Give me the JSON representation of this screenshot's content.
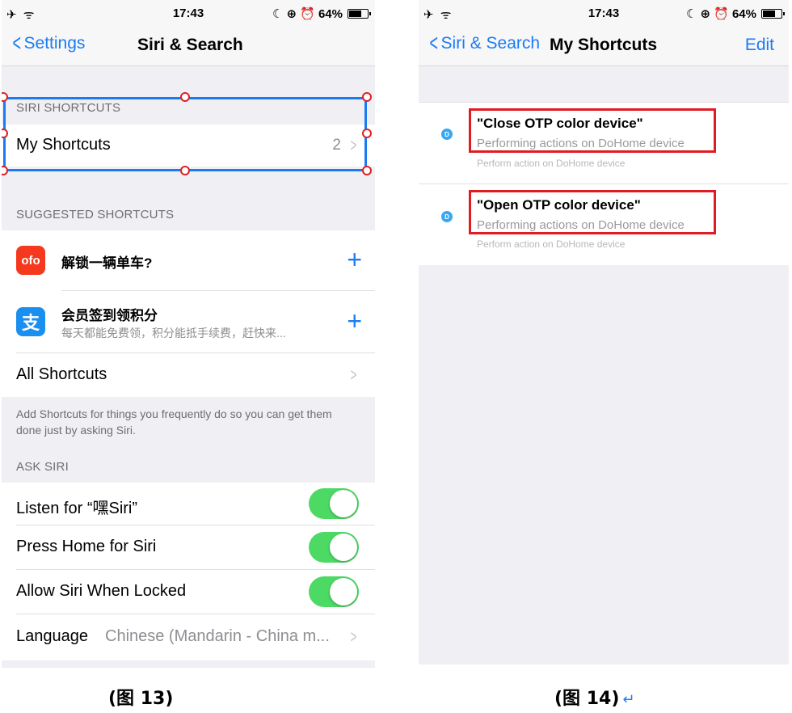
{
  "left_screen": {
    "status": {
      "left_icons": "✈ ᯤ",
      "time": "17:43",
      "right_icons": "☾ ⊕ ⏰",
      "battery": "64%",
      "battery_level": 0.64
    },
    "nav": {
      "back_label": "Settings",
      "title": "Siri & Search"
    },
    "siri_shortcuts": {
      "header": "SIRI SHORTCUTS",
      "my_shortcuts_label": "My Shortcuts",
      "my_shortcuts_count": "2"
    },
    "suggested": {
      "header": "SUGGESTED SHORTCUTS",
      "items": [
        {
          "icon": "bike-app-icon",
          "icon_color": "#f5391e",
          "title": "解锁一辆单车?",
          "subtitle": ""
        },
        {
          "icon": "alipay-app-icon",
          "icon_color": "#1b8ff0",
          "title": "会员签到领积分",
          "subtitle": "每天都能免费领，积分能抵手续费，赶快来..."
        }
      ],
      "all_shortcuts_label": "All Shortcuts",
      "footer": "Add Shortcuts for things you frequently do so you can get them done just by asking Siri."
    },
    "ask_siri": {
      "header": "ASK SIRI",
      "toggles": [
        {
          "label": "Listen for “嘿Siri”",
          "on": true
        },
        {
          "label": "Press Home for Siri",
          "on": true
        },
        {
          "label": "Allow Siri When Locked",
          "on": true
        }
      ],
      "language_label": "Language",
      "language_value": "Chinese (Mandarin - China m..."
    },
    "caption": "(图 13)"
  },
  "right_screen": {
    "status": {
      "left_icons": "✈ ᯤ",
      "time": "17:43",
      "right_icons": "☾ ⊕ ⏰",
      "battery": "64%",
      "battery_level": 0.64
    },
    "nav": {
      "back_label": "Siri & Search",
      "title": "My Shortcuts",
      "edit_label": "Edit"
    },
    "shortcuts": [
      {
        "dot_label": "D",
        "title": "\"Close OTP color device\"",
        "subtitle": "Performing actions on DoHome device",
        "detail": "Perform action on DoHome device"
      },
      {
        "dot_label": "D",
        "title": "\"Open OTP color device\"",
        "subtitle": "Performing actions on DoHome device",
        "detail": "Perform action on DoHome device"
      }
    ],
    "caption": "(图 14)",
    "return_mark": "↵"
  },
  "colors": {
    "ios_blue": "#1a7cf5",
    "toggle_green": "#4cd964",
    "highlight_red": "#e11b22",
    "selection_blue": "#1a7cf5"
  }
}
